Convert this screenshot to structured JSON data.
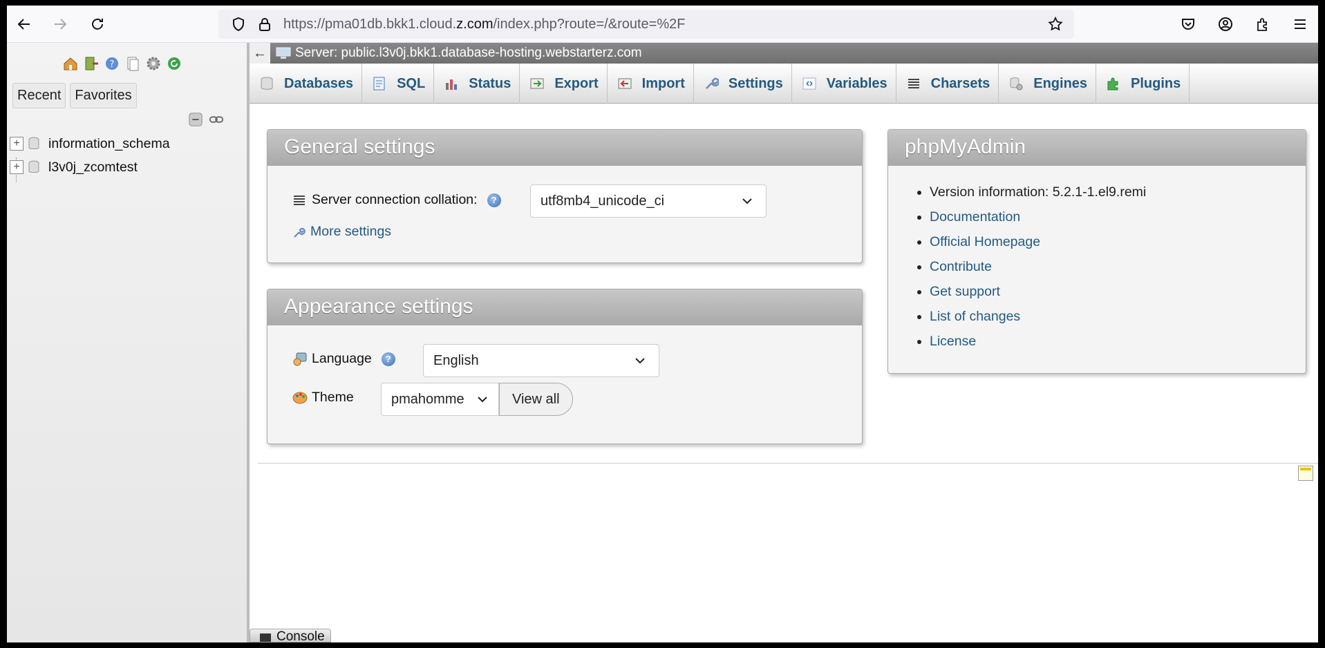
{
  "browser": {
    "url_prefix": "https://pma01db.bkk1.cloud.",
    "url_domain": "z.com",
    "url_suffix": "/index.php?route=/&route=%2F"
  },
  "nav": {
    "tabs": [
      "Recent",
      "Favorites"
    ],
    "databases": [
      "information_schema",
      "l3v0j_zcomtest"
    ]
  },
  "server_bar": {
    "title": "Server: public.l3v0j.bkk1.database-hosting.webstarterz.com"
  },
  "menu": {
    "tabs": [
      "Databases",
      "SQL",
      "Status",
      "Export",
      "Import",
      "Settings",
      "Variables",
      "Charsets",
      "Engines",
      "Plugins"
    ]
  },
  "general_settings": {
    "title": "General settings",
    "collation_label": "Server connection collation:",
    "collation_value": "utf8mb4_unicode_ci",
    "more_settings": "More settings"
  },
  "appearance_settings": {
    "title": "Appearance settings",
    "language_label": "Language",
    "language_value": "English",
    "theme_label": "Theme",
    "theme_value": "pmahomme",
    "view_all": "View all"
  },
  "pma_info": {
    "title": "phpMyAdmin",
    "version": "Version information: 5.2.1-1.el9.remi",
    "links": [
      "Documentation",
      "Official Homepage",
      "Contribute",
      "Get support",
      "List of changes",
      "License"
    ]
  },
  "console": {
    "label": "Console"
  }
}
